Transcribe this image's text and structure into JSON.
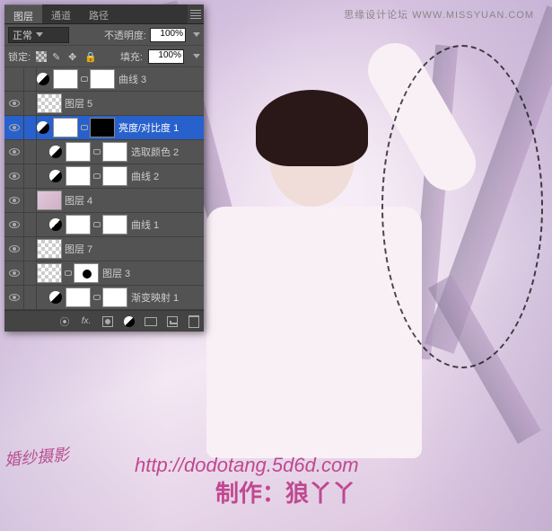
{
  "watermark_top": "思缘设计论坛  WWW.MISSYUAN.COM",
  "url_text": "http://dodotang.5d6d.com",
  "credit_text": "制作：狼丫丫",
  "corner_stamp": "婚纱摄影",
  "panel": {
    "tabs": [
      "图层",
      "通道",
      "路径"
    ],
    "active_tab": 0,
    "blend_mode": "正常",
    "opacity_label": "不透明度:",
    "opacity_value": "100%",
    "lock_label": "锁定:",
    "fill_label": "填充:",
    "fill_value": "100%"
  },
  "layers": [
    {
      "visible": false,
      "type": "adj",
      "mask": "white",
      "name": "曲线 3"
    },
    {
      "visible": true,
      "type": "raster",
      "thumb": "checker",
      "name": "图层 5"
    },
    {
      "visible": true,
      "type": "adj",
      "mask": "black",
      "name": "亮度/对比度 1",
      "selected": true
    },
    {
      "visible": true,
      "type": "adj",
      "indent": true,
      "mask": "white",
      "name": "选取颜色 2"
    },
    {
      "visible": true,
      "type": "adj",
      "indent": true,
      "mask": "white",
      "name": "曲线 2"
    },
    {
      "visible": true,
      "type": "raster",
      "thumb": "pinkish",
      "name": "图层 4"
    },
    {
      "visible": true,
      "type": "adj",
      "indent": true,
      "mask": "white",
      "name": "曲线 1"
    },
    {
      "visible": true,
      "type": "raster",
      "thumb": "checker",
      "name": "图层 7"
    },
    {
      "visible": true,
      "type": "raster",
      "thumb": "checker",
      "mask": "dot",
      "name": "图层 3"
    },
    {
      "visible": true,
      "type": "adj",
      "indent": true,
      "mask": "white",
      "name": "渐变映射 1",
      "cut": true
    }
  ]
}
